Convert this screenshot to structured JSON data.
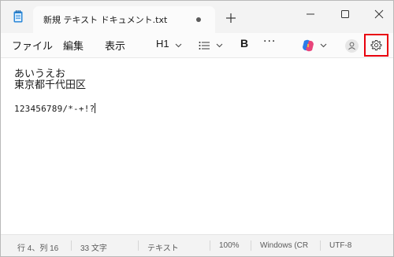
{
  "tab": {
    "title": "新規 テキスト ドキュメント.txt"
  },
  "menu": {
    "file": "ファイル",
    "edit": "編集",
    "view": "表示"
  },
  "toolbar": {
    "heading": "H1",
    "bold": "B",
    "more": "···"
  },
  "editor": {
    "lines": [
      "あいうえお",
      "東京都千代田区",
      "123456789/*-+!?"
    ]
  },
  "status": {
    "position": "行 4、列 16",
    "chars": "33 文字",
    "mode": "テキスト",
    "zoom": "100%",
    "line_ending": "Windows (CR",
    "encoding": "UTF-8"
  },
  "colors": {
    "highlight": "#e8000d",
    "accent": "#1e88c7"
  },
  "icons": [
    "notepad-app-icon",
    "plus-icon",
    "minimize-icon",
    "maximize-icon",
    "close-icon",
    "list-icon",
    "copilot-icon",
    "avatar-icon",
    "gear-icon",
    "chevron-down-icon"
  ]
}
